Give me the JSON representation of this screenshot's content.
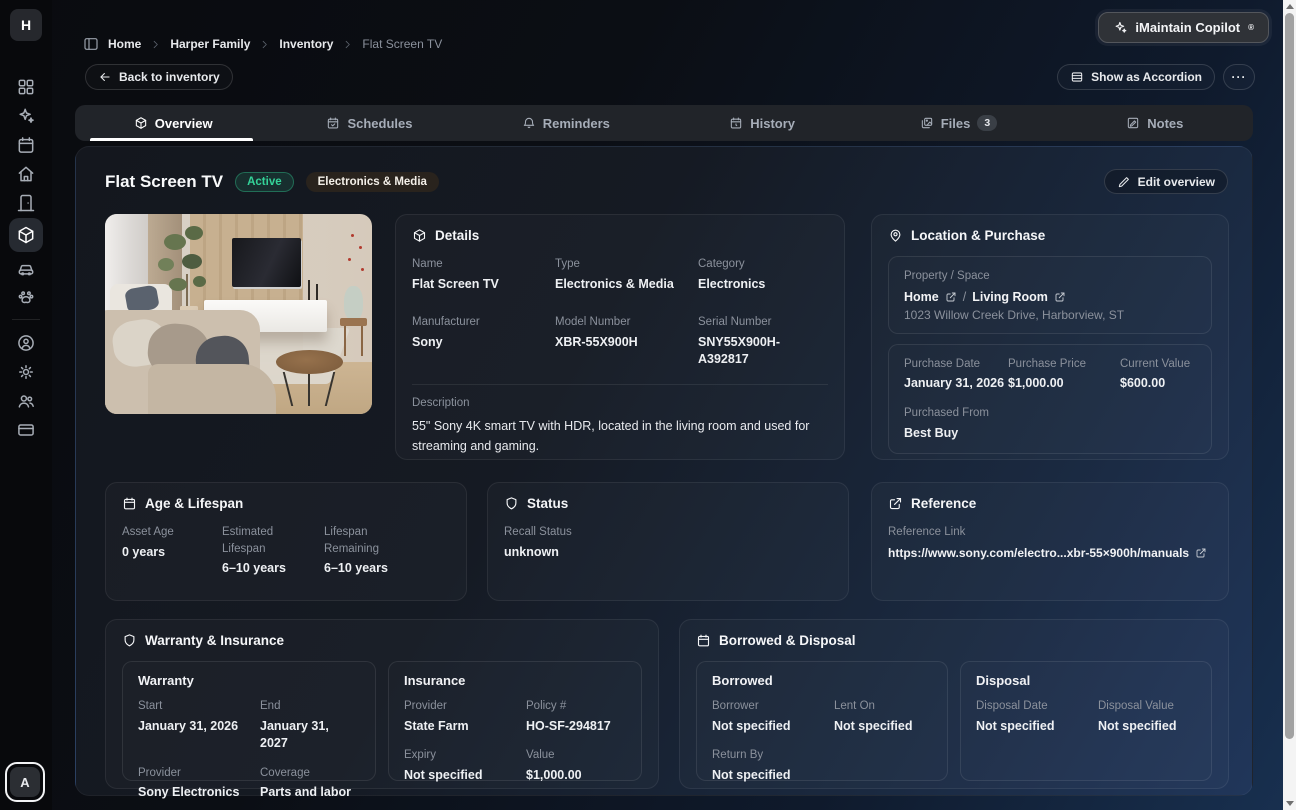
{
  "sidebar": {
    "logo": "H",
    "avatar_initial": "A",
    "icons": [
      "dashboard-grid",
      "copilot-sparkles",
      "calendar",
      "home",
      "rooms-door",
      "inventory-box",
      "vehicles-car",
      "pets-paw",
      "account",
      "settings",
      "family-members",
      "billing-card"
    ]
  },
  "header": {
    "copilot": {
      "label": "iMaintain Copilot",
      "registered": "®"
    },
    "breadcrumb": [
      "Home",
      "Harper Family",
      "Inventory",
      "Flat Screen TV"
    ],
    "back_button": "Back to inventory",
    "accordion_button": "Show as Accordion",
    "more_button": "···"
  },
  "tabs": [
    {
      "label": "Overview",
      "active": true
    },
    {
      "label": "Schedules"
    },
    {
      "label": "Reminders"
    },
    {
      "label": "History"
    },
    {
      "label": "Files",
      "badge": "3"
    },
    {
      "label": "Notes"
    }
  ],
  "overview": {
    "title": "Flat Screen TV",
    "status_badge": "Active",
    "category_chip": "Electronics & Media",
    "edit_button": "Edit overview",
    "details": {
      "title": "Details",
      "fields": [
        {
          "label": "Name",
          "value": "Flat Screen TV"
        },
        {
          "label": "Type",
          "value": "Electronics & Media"
        },
        {
          "label": "Category",
          "value": "Electronics"
        },
        {
          "label": "Manufacturer",
          "value": "Sony"
        },
        {
          "label": "Model Number",
          "value": "XBR-55X900H"
        },
        {
          "label": "Serial Number",
          "value": "SNY55X900H-A392817"
        }
      ],
      "description_label": "Description",
      "description": "55\" Sony 4K smart TV with HDR, located in the living room and used for streaming and gaming."
    },
    "location": {
      "title": "Location & Purchase",
      "property_label": "Property / Space",
      "property": "Home",
      "separator": "/",
      "space": "Living Room",
      "address": "1023 Willow Creek Drive, Harborview, ST",
      "purchase_fields": [
        {
          "label": "Purchase Date",
          "value": "January 31, 2026"
        },
        {
          "label": "Purchase Price",
          "value": "$1,000.00"
        },
        {
          "label": "Current Value",
          "value": "$600.00"
        },
        {
          "label": "Purchased From",
          "value": "Best Buy"
        }
      ]
    },
    "age": {
      "title": "Age & Lifespan",
      "fields": [
        {
          "label": "Asset Age",
          "value": "0 years"
        },
        {
          "label": "Estimated Lifespan",
          "value": "6–10 years"
        },
        {
          "label": "Lifespan Remaining",
          "value": "6–10 years"
        }
      ]
    },
    "status": {
      "title": "Status",
      "label": "Recall Status",
      "value": "unknown"
    },
    "reference": {
      "title": "Reference",
      "label": "Reference Link",
      "value": "https://www.sony.com/electro...xbr-55×900h/manuals"
    },
    "warranty": {
      "title": "Warranty & Insurance",
      "warranty_section": {
        "title": "Warranty",
        "fields": [
          {
            "label": "Start",
            "value": "January 31, 2026"
          },
          {
            "label": "End",
            "value": "January 31, 2027"
          },
          {
            "label": "Provider",
            "value": "Sony Electronics"
          },
          {
            "label": "Coverage",
            "value": "Parts and labor"
          }
        ]
      },
      "insurance_section": {
        "title": "Insurance",
        "fields": [
          {
            "label": "Provider",
            "value": "State Farm"
          },
          {
            "label": "Policy #",
            "value": "HO-SF-294817"
          },
          {
            "label": "Expiry",
            "value": "Not specified"
          },
          {
            "label": "Value",
            "value": "$1,000.00"
          }
        ]
      }
    },
    "borrowed": {
      "title": "Borrowed & Disposal",
      "borrowed_section": {
        "title": "Borrowed",
        "fields": [
          {
            "label": "Borrower",
            "value": "Not specified"
          },
          {
            "label": "Lent On",
            "value": "Not specified"
          },
          {
            "label": "Return By",
            "value": "Not specified"
          }
        ]
      },
      "disposal_section": {
        "title": "Disposal",
        "fields": [
          {
            "label": "Disposal Date",
            "value": "Not specified"
          },
          {
            "label": "Disposal Value",
            "value": "Not specified"
          }
        ]
      }
    }
  },
  "colors": {
    "accent_green": "#34d399",
    "panel_blue": "#20365a",
    "background_dark": "#0a0b0f"
  }
}
